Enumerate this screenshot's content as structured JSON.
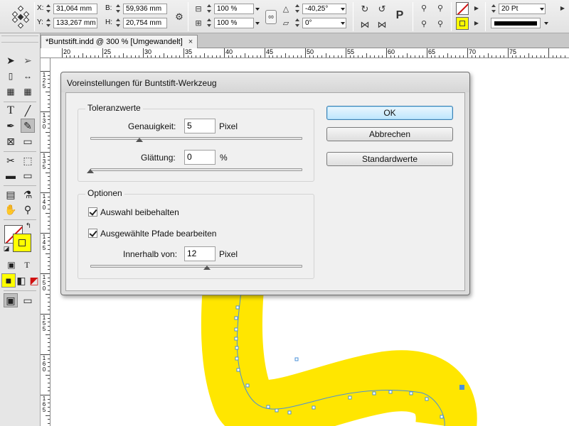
{
  "control_bar": {
    "x_label": "X:",
    "x_value": "31,064 mm",
    "y_label": "Y:",
    "y_value": "133,267 mm",
    "b_label": "B:",
    "b_value": "59,936 mm",
    "h_label": "H:",
    "h_value": "20,754 mm",
    "scale_x": "100 %",
    "scale_y": "100 %",
    "rotation": "-40,25°",
    "shear": "0°",
    "stroke_weight": "20 Pt"
  },
  "document_tab": {
    "title": "*Buntstift.indd @ 300 % [Umgewandelt]",
    "close": "×"
  },
  "ruler": {
    "h_numbers": [
      "20",
      "25",
      "30",
      "35",
      "40",
      "45",
      "50",
      "55",
      "60",
      "65",
      "70",
      "75"
    ],
    "v_numbers": [
      "125",
      "130",
      "135",
      "140",
      "145",
      "150",
      "155",
      "160",
      "165"
    ]
  },
  "dialog": {
    "title": "Voreinstellungen für Buntstift-Werkzeug",
    "tolerance_group": "Toleranzwerte",
    "accuracy_label": "Genauigkeit:",
    "accuracy_value": "5",
    "accuracy_unit": "Pixel",
    "accuracy_slider": 0.23,
    "smoothing_label": "Glättung:",
    "smoothing_value": "0",
    "smoothing_unit": "%",
    "smoothing_slider": 0.0,
    "options_group": "Optionen",
    "keep_selected_label": "Auswahl beibehalten",
    "keep_selected_checked": true,
    "edit_paths_label": "Ausgewählte Pfade bearbeiten",
    "edit_paths_checked": true,
    "within_label": "Innerhalb von:",
    "within_value": "12",
    "within_unit": "Pixel",
    "within_slider": 0.55,
    "ok_button": "OK",
    "cancel_button": "Abbrechen",
    "defaults_button": "Standardwerte"
  },
  "colors": {
    "stroke_yellow": "#ffe600",
    "path_blue": "#4a90d9",
    "fill_swatch": "#ffff00"
  }
}
